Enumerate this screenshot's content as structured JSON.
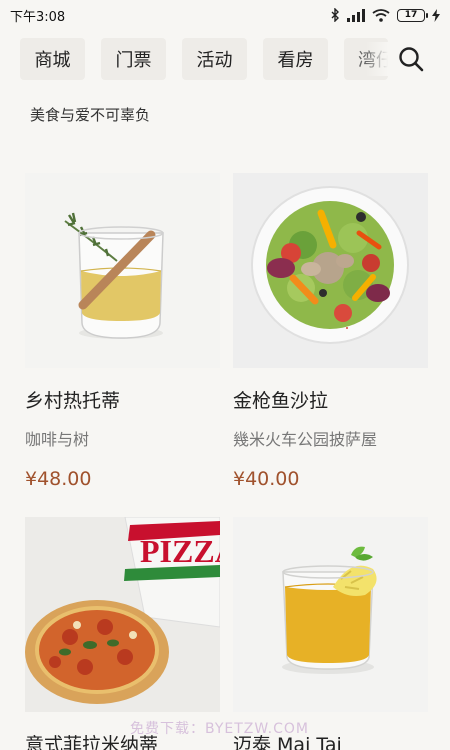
{
  "status_bar": {
    "time": "下午3:08",
    "battery": "17"
  },
  "nav": {
    "tabs": [
      "商城",
      "门票",
      "活动",
      "看房",
      "湾仔"
    ],
    "search_icon": "search-icon"
  },
  "tagline": "美食与爱不可辜负",
  "products": [
    {
      "title": "乡村热托蒂",
      "shop": "咖啡与树",
      "price": "¥48.00"
    },
    {
      "title": "金枪鱼沙拉",
      "shop": "幾米火车公园披萨屋",
      "price": "¥40.00"
    },
    {
      "title": "意式菲拉米纳蒂",
      "shop": "",
      "price": ""
    },
    {
      "title": "迈泰 Mai Tai",
      "shop": "",
      "price": ""
    }
  ],
  "pizza_box_text": "PIZZA",
  "watermark": "免费下载：BYETZW.COM",
  "colors": {
    "price": "#a0522d",
    "tab_bg": "#eeece8",
    "page_bg": "#f7f6f3"
  }
}
